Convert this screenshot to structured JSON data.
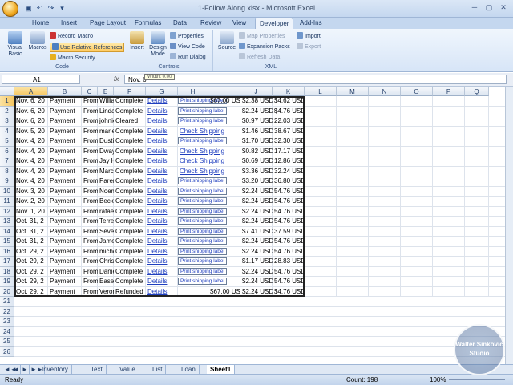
{
  "window": {
    "title": "1-Follow Along.xlsx - Microsoft Excel"
  },
  "ribbon_tabs": [
    "Home",
    "Insert",
    "Page Layout",
    "Formulas",
    "Data",
    "Review",
    "View",
    "Developer",
    "Add-Ins"
  ],
  "active_tab": "Developer",
  "ribbon": {
    "code": {
      "label": "Code",
      "visual_basic": "Visual Basic",
      "macros": "Macros",
      "record_macro": "Record Macro",
      "relative_refs": "Use Relative References",
      "macro_security": "Macro Security"
    },
    "controls": {
      "label": "Controls",
      "insert": "Insert",
      "design_mode": "Design Mode",
      "properties": "Properties",
      "view_code": "View Code",
      "run_dialog": "Run Dialog"
    },
    "xml": {
      "label": "XML",
      "source": "Source",
      "map_properties": "Map Properties",
      "expansion_packs": "Expansion Packs",
      "refresh_data": "Refresh Data",
      "import": "Import",
      "export": "Export"
    }
  },
  "formula_bar": {
    "name_box": "A1",
    "fx": "fx",
    "content": "Nov. 6",
    "tooltip": "Width: 0.00"
  },
  "columns": [
    "A",
    "B",
    "C",
    "D",
    "E",
    "F",
    "G",
    "H",
    "I",
    "J",
    "K",
    "L",
    "M",
    "N",
    "O",
    "P",
    "Q"
  ],
  "rows": [
    {
      "a": "Nov. 6, 20",
      "b": "Payment",
      "c": "From",
      "e": "William R",
      "f": "Complete",
      "g": "Details",
      "h": "Print shipping label",
      "i": "$67.00 USD",
      "j": "$2.38 USD",
      "k": "$4.62 USD"
    },
    {
      "a": "Nov. 6, 20",
      "b": "Payment",
      "c": "From",
      "e": "Linda Eige",
      "f": "Complete",
      "g": "Details",
      "h": "Print shipping label",
      "i": "",
      "j": "$2.24 USD",
      "k": "$4.76 USD"
    },
    {
      "a": "Nov. 6, 20",
      "b": "Payment",
      "c": "From",
      "e": "johnie ea",
      "f": "Cleared",
      "g": "Details",
      "h": "Print shipping label",
      "i": "",
      "j": "$0.97 USD",
      "k": "22.03 USD"
    },
    {
      "a": "Nov. 5, 20",
      "b": "Payment",
      "c": "From",
      "e": "mariesen",
      "f": "Complete",
      "g": "Details",
      "h": "Check Shipping",
      "i": "",
      "j": "$1.46 USD",
      "k": "38.67 USD"
    },
    {
      "a": "Nov. 4, 20",
      "b": "Payment",
      "c": "From",
      "e": "DustinStr",
      "f": "Complete",
      "g": "Details",
      "h": "Print shipping label",
      "i": "",
      "j": "$1.70 USD",
      "k": "32.30 USD"
    },
    {
      "a": "Nov. 4, 20",
      "b": "Payment",
      "c": "From",
      "e": "Dwayne H",
      "f": "Complete",
      "g": "Details",
      "h": "Check Shipping",
      "i": "",
      "j": "$0.82 USD",
      "k": "17.17 USD"
    },
    {
      "a": "Nov. 4, 20",
      "b": "Payment",
      "c": "From",
      "e": "Jay Hicks",
      "f": "Complete",
      "g": "Details",
      "h": "Check Shipping",
      "i": "",
      "j": "$0.69 USD",
      "k": "12.86 USD"
    },
    {
      "a": "Nov. 4, 20",
      "b": "Payment",
      "c": "From",
      "e": "Marc de R",
      "f": "Complete",
      "g": "Details",
      "h": "Check Shipping",
      "i": "",
      "j": "$3.36 USD",
      "k": "32.24 USD"
    },
    {
      "a": "Nov. 4, 20",
      "b": "Payment",
      "c": "From",
      "e": "Parental C",
      "f": "Complete",
      "g": "Details",
      "h": "Print shipping label",
      "i": "",
      "j": "$3.20 USD",
      "k": "36.80 USD"
    },
    {
      "a": "Nov. 3, 20",
      "b": "Payment",
      "c": "From",
      "e": "Noemi Va",
      "f": "Complete",
      "g": "Details",
      "h": "Print shipping label",
      "i": "",
      "j": "$2.24 USD",
      "k": "54.76 USD"
    },
    {
      "a": "Nov. 2, 20",
      "b": "Payment",
      "c": "From",
      "e": "Becky Lyle",
      "f": "Complete",
      "g": "Details",
      "h": "Print shipping label",
      "i": "",
      "j": "$2.24 USD",
      "k": "54.76 USD"
    },
    {
      "a": "Nov. 1, 20",
      "b": "Payment",
      "c": "From",
      "e": "rafael ald",
      "f": "Complete",
      "g": "Details",
      "h": "Print shipping label",
      "i": "",
      "j": "$2.24 USD",
      "k": "54.76 USD"
    },
    {
      "a": "Oct. 31, 2",
      "b": "Payment",
      "c": "From",
      "e": "Terrence",
      "f": "Complete",
      "g": "Details",
      "h": "Print shipping label",
      "i": "",
      "j": "$2.24 USD",
      "k": "54.76 USD"
    },
    {
      "a": "Oct. 31, 2",
      "b": "Payment",
      "c": "From",
      "e": "Seven Fo",
      "f": "Complete",
      "g": "Details",
      "h": "Print shipping label",
      "i": "",
      "j": "$7.41 USD",
      "k": "37.59 USD"
    },
    {
      "a": "Oct. 31, 2",
      "b": "Payment",
      "c": "From",
      "e": "James Ca",
      "f": "Complete",
      "g": "Details",
      "h": "Print shipping label",
      "i": "",
      "j": "$2.24 USD",
      "k": "54.76 USD"
    },
    {
      "a": "Oct. 29, 2",
      "b": "Payment",
      "c": "From",
      "e": "michelle",
      "f": "Complete",
      "g": "Details",
      "h": "Print shipping label",
      "i": "",
      "j": "$2.24 USD",
      "k": "54.76 USD"
    },
    {
      "a": "Oct. 29, 2",
      "b": "Payment",
      "c": "From",
      "e": "Chris Farr",
      "f": "Complete",
      "g": "Details",
      "h": "Print shipping label",
      "i": "",
      "j": "$1.17 USD",
      "k": "28.83 USD"
    },
    {
      "a": "Oct. 29, 2",
      "b": "Payment",
      "c": "From",
      "e": "Daniel Ca",
      "f": "Complete",
      "g": "Details",
      "h": "Print shipping label",
      "i": "",
      "j": "$2.24 USD",
      "k": "54.76 USD"
    },
    {
      "a": "Oct. 29, 2",
      "b": "Payment",
      "c": "From",
      "e": "Ease Into",
      "f": "Complete",
      "g": "Details",
      "h": "Print shipping label",
      "i": "",
      "j": "$2.24 USD",
      "k": "54.76 USD"
    },
    {
      "a": "Oct. 29, 2",
      "b": "Payment",
      "c": "From",
      "e": "Veronica",
      "f": "Refunded",
      "g": "Details",
      "h": "",
      "i": "$67.00 USD",
      "j": "$2.24 USD",
      "k": "$4.76 USD"
    }
  ],
  "row_numbers": [
    "1",
    "2",
    "3",
    "4",
    "5",
    "6",
    "7",
    "8",
    "9",
    "10",
    "11",
    "12",
    "13",
    "14",
    "15",
    "16",
    "17",
    "18",
    "19",
    "20",
    "21",
    "22",
    "23",
    "24",
    "25",
    "26"
  ],
  "sheet_tabs": [
    "Inventory",
    "Text",
    "Value",
    "List",
    "Loan",
    "Sheet1"
  ],
  "active_sheet": "Sheet1",
  "status": {
    "ready": "Ready",
    "count": "Count: 198",
    "zoom": "100%"
  },
  "watermark": {
    "line1": "Walter Sinkovic",
    "line2": "Studio"
  }
}
